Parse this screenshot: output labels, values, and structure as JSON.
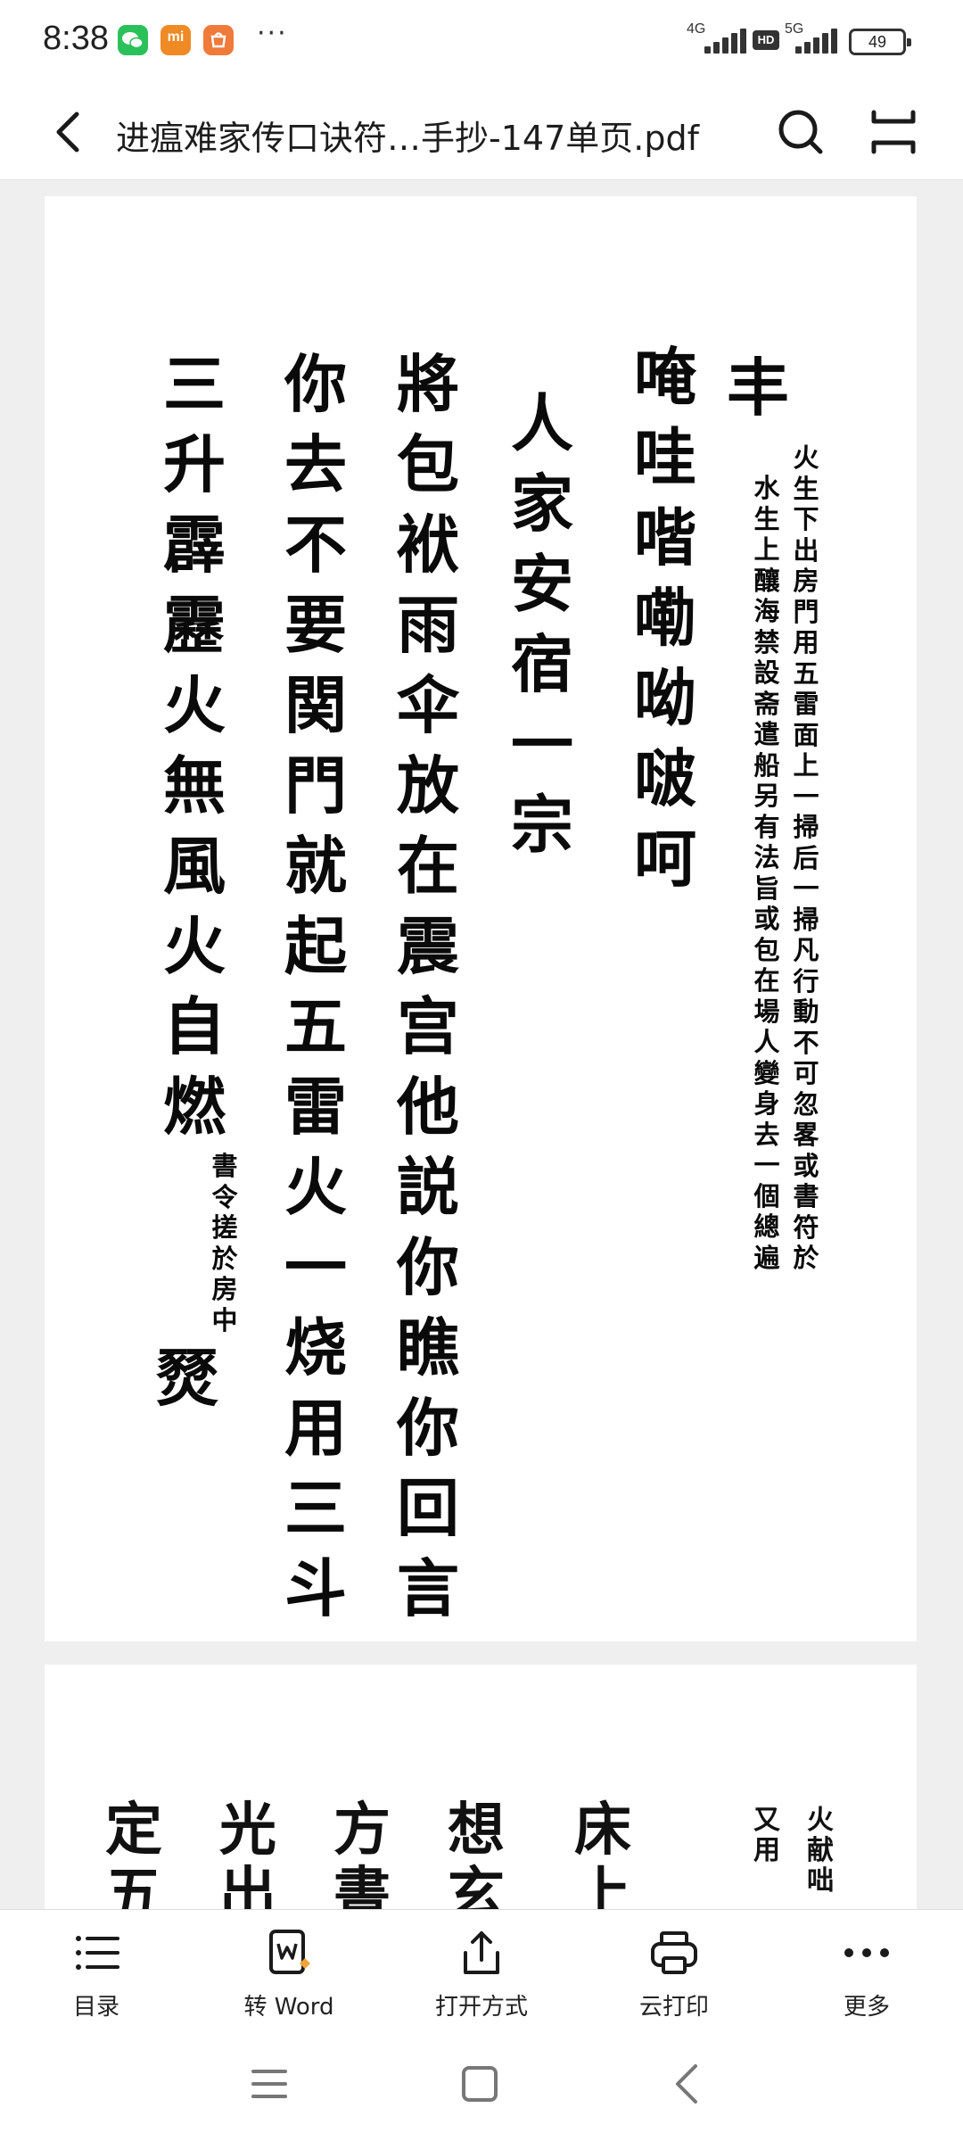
{
  "status_bar": {
    "time": "8:38",
    "notifications": [
      "wechat-icon",
      "mi-icon",
      "shop-icon"
    ],
    "mi_label": "mi",
    "more": "···",
    "network_1": "4G",
    "network_2": "5G",
    "hd_label": "HD",
    "battery": "49"
  },
  "header": {
    "title": "进瘟难家传口诀符…手抄-147单页.pdf"
  },
  "page1": {
    "lead": "丰",
    "note_right": [
      "火",
      "生",
      "下",
      "出",
      "房",
      "門",
      "用",
      "五",
      "雷",
      "面",
      "上",
      "一",
      "掃",
      "后",
      "一",
      "掃",
      "凡",
      "行",
      "動",
      "不",
      "可",
      "忽",
      "畧",
      "或",
      "書",
      "符",
      "於"
    ],
    "note_left": [
      "水",
      "生",
      "上",
      "釀",
      "海",
      "禁",
      "設",
      "斋",
      "遣",
      "船",
      "另",
      "有",
      "法",
      "旨",
      "或",
      "包",
      "在",
      "場",
      "人",
      "變",
      "身",
      "去",
      "一",
      "個",
      "總",
      "遍"
    ],
    "incantation": [
      "唵",
      "哇",
      "喈",
      "嘞",
      "呦",
      "啵",
      "呵"
    ],
    "anjia": [
      "人",
      "家",
      "安",
      "宿",
      "一",
      "宗"
    ],
    "jiang": [
      "將",
      "包",
      "袱",
      "雨",
      "伞",
      "放",
      "在",
      "震",
      "宫",
      "他",
      "説",
      "你",
      "瞧",
      "你",
      "回",
      "言"
    ],
    "ni": [
      "你",
      "去",
      "不",
      "要",
      "関",
      "門",
      "就",
      "起",
      "五",
      "雷",
      "火",
      "一",
      "烧",
      "用",
      "三",
      "斗"
    ],
    "san": [
      "三",
      "升",
      "霹",
      "靂",
      "火",
      "無",
      "風",
      "火",
      "自",
      "燃"
    ],
    "san_note": [
      "書",
      "令",
      "搓",
      "於",
      "房",
      "中"
    ],
    "final": "燹"
  },
  "page2": {
    "col1": [
      "定",
      "五"
    ],
    "col2": [
      "光",
      "出"
    ],
    "col3": [
      "方",
      "書"
    ],
    "col4": [
      "想",
      "玄"
    ],
    "col5": [
      "床",
      "上"
    ],
    "col6": [
      "火",
      "献",
      "咄"
    ],
    "col7": [
      "又",
      "用"
    ]
  },
  "toolbar": {
    "items": [
      {
        "label": "目录",
        "icon": "list-icon"
      },
      {
        "label": "转 Word",
        "icon": "convert-word-icon"
      },
      {
        "label": "打开方式",
        "icon": "share-icon"
      },
      {
        "label": "云打印",
        "icon": "printer-icon"
      },
      {
        "label": "更多",
        "icon": "more-icon"
      }
    ]
  },
  "system_nav": {
    "buttons": [
      "menu-icon",
      "home-icon",
      "back-icon"
    ]
  }
}
